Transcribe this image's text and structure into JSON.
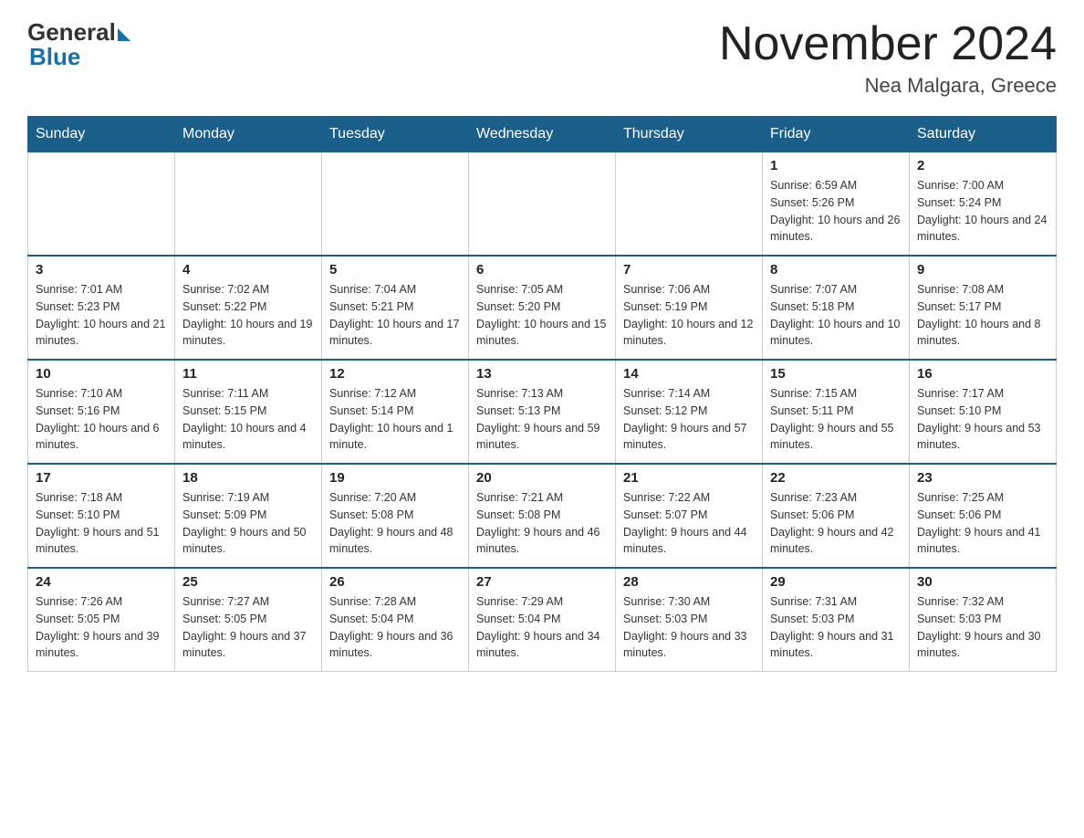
{
  "logo": {
    "general": "General",
    "blue": "Blue"
  },
  "title": "November 2024",
  "location": "Nea Malgara, Greece",
  "days_header": [
    "Sunday",
    "Monday",
    "Tuesday",
    "Wednesday",
    "Thursday",
    "Friday",
    "Saturday"
  ],
  "weeks": [
    [
      {
        "num": "",
        "info": ""
      },
      {
        "num": "",
        "info": ""
      },
      {
        "num": "",
        "info": ""
      },
      {
        "num": "",
        "info": ""
      },
      {
        "num": "",
        "info": ""
      },
      {
        "num": "1",
        "info": "Sunrise: 6:59 AM\nSunset: 5:26 PM\nDaylight: 10 hours and 26 minutes."
      },
      {
        "num": "2",
        "info": "Sunrise: 7:00 AM\nSunset: 5:24 PM\nDaylight: 10 hours and 24 minutes."
      }
    ],
    [
      {
        "num": "3",
        "info": "Sunrise: 7:01 AM\nSunset: 5:23 PM\nDaylight: 10 hours and 21 minutes."
      },
      {
        "num": "4",
        "info": "Sunrise: 7:02 AM\nSunset: 5:22 PM\nDaylight: 10 hours and 19 minutes."
      },
      {
        "num": "5",
        "info": "Sunrise: 7:04 AM\nSunset: 5:21 PM\nDaylight: 10 hours and 17 minutes."
      },
      {
        "num": "6",
        "info": "Sunrise: 7:05 AM\nSunset: 5:20 PM\nDaylight: 10 hours and 15 minutes."
      },
      {
        "num": "7",
        "info": "Sunrise: 7:06 AM\nSunset: 5:19 PM\nDaylight: 10 hours and 12 minutes."
      },
      {
        "num": "8",
        "info": "Sunrise: 7:07 AM\nSunset: 5:18 PM\nDaylight: 10 hours and 10 minutes."
      },
      {
        "num": "9",
        "info": "Sunrise: 7:08 AM\nSunset: 5:17 PM\nDaylight: 10 hours and 8 minutes."
      }
    ],
    [
      {
        "num": "10",
        "info": "Sunrise: 7:10 AM\nSunset: 5:16 PM\nDaylight: 10 hours and 6 minutes."
      },
      {
        "num": "11",
        "info": "Sunrise: 7:11 AM\nSunset: 5:15 PM\nDaylight: 10 hours and 4 minutes."
      },
      {
        "num": "12",
        "info": "Sunrise: 7:12 AM\nSunset: 5:14 PM\nDaylight: 10 hours and 1 minute."
      },
      {
        "num": "13",
        "info": "Sunrise: 7:13 AM\nSunset: 5:13 PM\nDaylight: 9 hours and 59 minutes."
      },
      {
        "num": "14",
        "info": "Sunrise: 7:14 AM\nSunset: 5:12 PM\nDaylight: 9 hours and 57 minutes."
      },
      {
        "num": "15",
        "info": "Sunrise: 7:15 AM\nSunset: 5:11 PM\nDaylight: 9 hours and 55 minutes."
      },
      {
        "num": "16",
        "info": "Sunrise: 7:17 AM\nSunset: 5:10 PM\nDaylight: 9 hours and 53 minutes."
      }
    ],
    [
      {
        "num": "17",
        "info": "Sunrise: 7:18 AM\nSunset: 5:10 PM\nDaylight: 9 hours and 51 minutes."
      },
      {
        "num": "18",
        "info": "Sunrise: 7:19 AM\nSunset: 5:09 PM\nDaylight: 9 hours and 50 minutes."
      },
      {
        "num": "19",
        "info": "Sunrise: 7:20 AM\nSunset: 5:08 PM\nDaylight: 9 hours and 48 minutes."
      },
      {
        "num": "20",
        "info": "Sunrise: 7:21 AM\nSunset: 5:08 PM\nDaylight: 9 hours and 46 minutes."
      },
      {
        "num": "21",
        "info": "Sunrise: 7:22 AM\nSunset: 5:07 PM\nDaylight: 9 hours and 44 minutes."
      },
      {
        "num": "22",
        "info": "Sunrise: 7:23 AM\nSunset: 5:06 PM\nDaylight: 9 hours and 42 minutes."
      },
      {
        "num": "23",
        "info": "Sunrise: 7:25 AM\nSunset: 5:06 PM\nDaylight: 9 hours and 41 minutes."
      }
    ],
    [
      {
        "num": "24",
        "info": "Sunrise: 7:26 AM\nSunset: 5:05 PM\nDaylight: 9 hours and 39 minutes."
      },
      {
        "num": "25",
        "info": "Sunrise: 7:27 AM\nSunset: 5:05 PM\nDaylight: 9 hours and 37 minutes."
      },
      {
        "num": "26",
        "info": "Sunrise: 7:28 AM\nSunset: 5:04 PM\nDaylight: 9 hours and 36 minutes."
      },
      {
        "num": "27",
        "info": "Sunrise: 7:29 AM\nSunset: 5:04 PM\nDaylight: 9 hours and 34 minutes."
      },
      {
        "num": "28",
        "info": "Sunrise: 7:30 AM\nSunset: 5:03 PM\nDaylight: 9 hours and 33 minutes."
      },
      {
        "num": "29",
        "info": "Sunrise: 7:31 AM\nSunset: 5:03 PM\nDaylight: 9 hours and 31 minutes."
      },
      {
        "num": "30",
        "info": "Sunrise: 7:32 AM\nSunset: 5:03 PM\nDaylight: 9 hours and 30 minutes."
      }
    ]
  ]
}
